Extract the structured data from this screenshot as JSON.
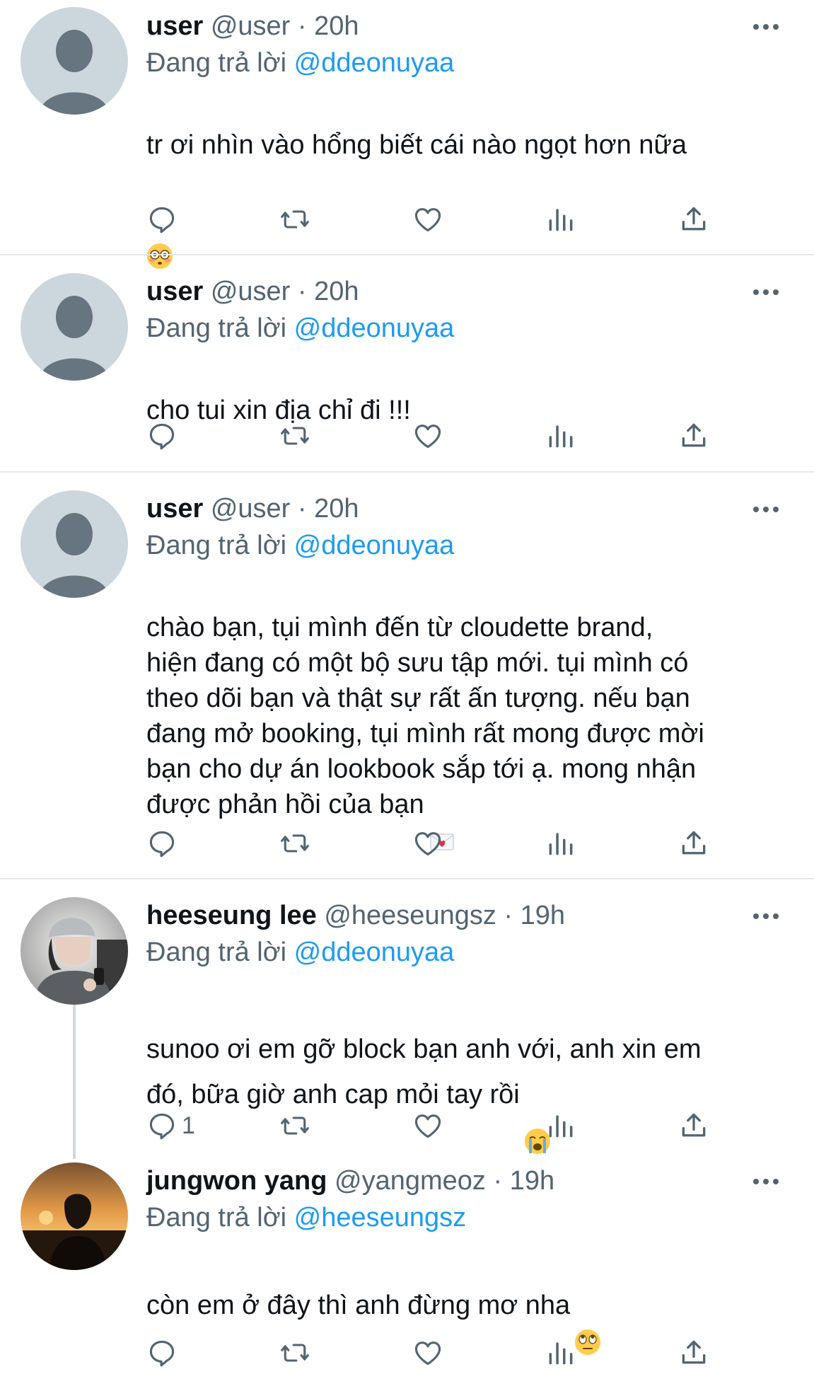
{
  "tweets": [
    {
      "name": "user",
      "handle": "@user",
      "separator": " · ",
      "time": "20h",
      "replying_prefix": "Đang trả lời ",
      "replying_to": "@ddeonuyaa",
      "text": "tr ơi nhìn vào hổng biết cái nào ngọt hơn nữa",
      "emoji": "flushed-face",
      "reply_count": ""
    },
    {
      "name": "user",
      "handle": "@user",
      "separator": " · ",
      "time": "20h",
      "replying_prefix": "Đang trả lời ",
      "replying_to": "@ddeonuyaa",
      "text": "cho tui xin địa chỉ đi !!!",
      "emoji": "",
      "reply_count": ""
    },
    {
      "name": "user",
      "handle": "@user",
      "separator": " · ",
      "time": "20h",
      "replying_prefix": "Đang trả lời ",
      "replying_to": "@ddeonuyaa",
      "text": "chào bạn, tụi mình đến từ cloudette brand,\nhiện đang có một bộ sưu tập mới. tụi mình có\ntheo dõi bạn và thật sự rất ấn tượng. nếu bạn\nđang mở booking, tụi mình rất mong được mời\nbạn cho dự án lookbook sắp tới ạ. mong nhận\nđược phản hồi của bạn",
      "emoji": "love-letter",
      "reply_count": ""
    },
    {
      "name": "heeseung lee",
      "handle": "@heeseungsz",
      "separator": " · ",
      "time": "19h",
      "replying_prefix": "Đang trả lời ",
      "replying_to": "@ddeonuyaa",
      "text": "sunoo ơi em gỡ block bạn anh với, anh xin em\nđó, bữa giờ anh cap mỏi tay rồi",
      "emoji": "loudly-crying-face",
      "reply_count": "1"
    },
    {
      "name": "jungwon yang",
      "handle": "@yangmeoz",
      "separator": " · ",
      "time": "19h",
      "replying_prefix": "Đang trả lời ",
      "replying_to": "@heeseungsz",
      "text": "còn em ở đây thì anh đừng mơ nha",
      "emoji": "eye-roll-face",
      "reply_count": ""
    }
  ],
  "icons": {
    "reply": "reply-icon",
    "retweet": "retweet-icon",
    "like": "like-icon",
    "views": "views-icon",
    "share": "share-icon",
    "more": "more-icon"
  },
  "colors": {
    "accent": "#1d9bf0",
    "muted": "#536471",
    "text": "#0f1419",
    "divider": "#e6e9eb"
  }
}
